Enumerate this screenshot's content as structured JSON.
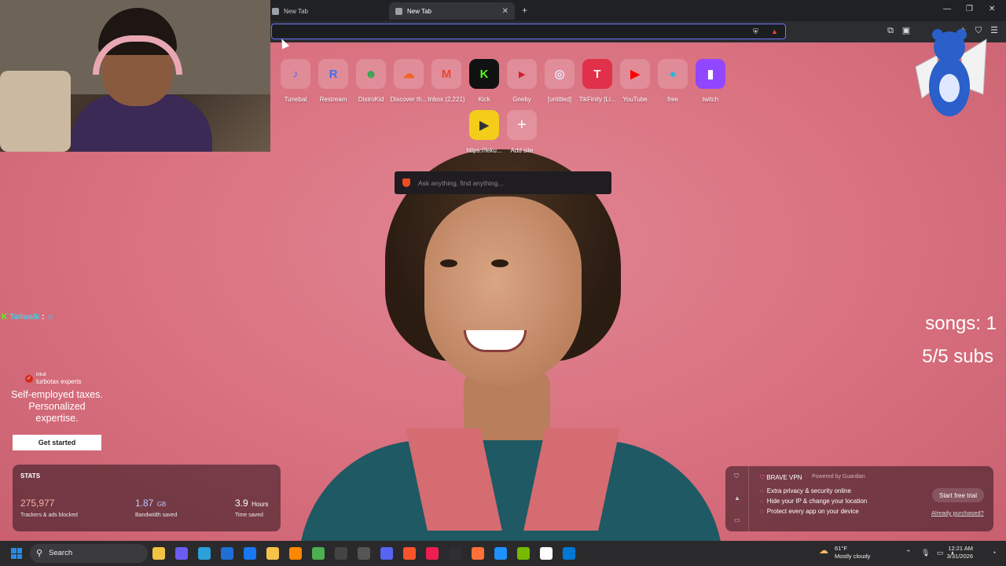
{
  "browser": {
    "tabs": [
      {
        "label": "New Tab"
      },
      {
        "label": "New Tab"
      }
    ],
    "window_controls": {
      "minimize": "—",
      "maximize": "❐",
      "close": "✕"
    }
  },
  "shortcuts": [
    {
      "label": "Tunebat",
      "glyph": "♪",
      "color": "#5a6cf0"
    },
    {
      "label": "Restream",
      "glyph": "R",
      "color": "#3d6ff0"
    },
    {
      "label": "DistroKid",
      "glyph": "☻",
      "color": "#2fa84f"
    },
    {
      "label": "Discover th...",
      "glyph": "☁",
      "color": "#f26522"
    },
    {
      "label": "Inbox (2,221)",
      "glyph": "M",
      "color": "#ea4335"
    },
    {
      "label": "Kick",
      "glyph": "K",
      "color": "#53fc18"
    },
    {
      "label": "Gneby",
      "glyph": "▸",
      "color": "#d21f2f"
    },
    {
      "label": "[untitled]",
      "glyph": "◎",
      "color": "#c9b4e8"
    },
    {
      "label": "TikFinity [Li...",
      "glyph": "T",
      "color": "#e0304a"
    },
    {
      "label": "YouTube",
      "glyph": "▶",
      "color": "#ff0000"
    },
    {
      "label": "free",
      "glyph": "●",
      "color": "#2fb6d6"
    },
    {
      "label": "twitch",
      "glyph": "▮",
      "color": "#9146ff"
    },
    {
      "label": "https://leku...",
      "glyph": "▶",
      "color": "#f4cc1a"
    },
    {
      "label": "Add site",
      "glyph": "+",
      "color": "#8a8a8a"
    }
  ],
  "search": {
    "placeholder": "Ask anything, find anything..."
  },
  "overlay": {
    "chat_user": "Tailwalk",
    "chat_prefix": "K",
    "songs": "songs: 1",
    "subs": "5/5 subs"
  },
  "ad": {
    "brand_top": "intuit",
    "brand_name": "turbotax experts",
    "headline": "Self-employed taxes. Personalized expertise.",
    "cta": "Get started"
  },
  "stats": {
    "title": "STATS",
    "items": [
      {
        "value": "275,977",
        "unit": "",
        "label": "Trackers & ads blocked",
        "color": "#f7b3a8"
      },
      {
        "value": "1.87",
        "unit": "GB",
        "label": "Bandwidth saved",
        "color": "#b9c8ff"
      },
      {
        "value": "3.9",
        "unit": "Hours",
        "label": "Time saved",
        "color": "#ffffff"
      }
    ]
  },
  "vpn": {
    "title": "BRAVE VPN",
    "powered": "Powered by  Guardian",
    "features": [
      "Extra privacy & security online",
      "Hide your IP & change your location",
      "Protect every app on your device"
    ],
    "cta": "Start free trial",
    "link": "Already purchased?"
  },
  "taskbar": {
    "search_label": "Search",
    "weather_temp": "61°F",
    "weather_desc": "Mostly cloudy",
    "time": "12:21 AM",
    "date": "3/31/2026",
    "apps": [
      {
        "name": "file-explorer",
        "color": "#f3c443"
      },
      {
        "name": "copilot",
        "color": "#6a5cf0"
      },
      {
        "name": "edge",
        "color": "#2aa1d8"
      },
      {
        "name": "outlook",
        "color": "#1f6fd6"
      },
      {
        "name": "facebook",
        "color": "#1877f2"
      },
      {
        "name": "folder",
        "color": "#f5c24a"
      },
      {
        "name": "vlc",
        "color": "#ff8800"
      },
      {
        "name": "minecraft",
        "color": "#4caf50"
      },
      {
        "name": "4k",
        "color": "#444"
      },
      {
        "name": "equalizer",
        "color": "#555"
      },
      {
        "name": "discord",
        "color": "#5865f2"
      },
      {
        "name": "brave",
        "color": "#fb542b"
      },
      {
        "name": "tiktok",
        "color": "#ee1d52"
      },
      {
        "name": "obs",
        "color": "#302e31"
      },
      {
        "name": "firefox",
        "color": "#ff7139"
      },
      {
        "name": "photos",
        "color": "#1e90ff"
      },
      {
        "name": "nvidia",
        "color": "#76b900"
      },
      {
        "name": "notepad",
        "color": "#ffffff"
      },
      {
        "name": "store",
        "color": "#0078d4"
      }
    ]
  }
}
